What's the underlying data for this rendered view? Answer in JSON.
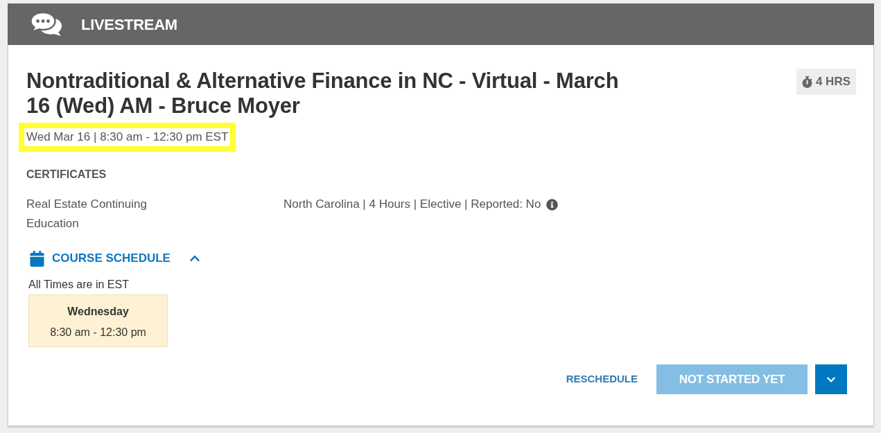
{
  "header": {
    "title": "LIVESTREAM"
  },
  "course": {
    "title": "Nontraditional & Alternative Finance in NC - Virtual - March 16 (Wed) AM - Bruce Moyer",
    "duration": "4 HRS",
    "date": {
      "text": "Wed Mar 16 | 8:30 am - 12:30 pm EST",
      "highlighted": true
    }
  },
  "certificates": {
    "heading": "CERTIFICATES",
    "rows": [
      {
        "name": "Real Estate Continuing Education",
        "details": "North Carolina | 4 Hours | Elective | Reported: No"
      }
    ]
  },
  "schedule": {
    "label": "COURSE SCHEDULE",
    "expanded": true,
    "note": "All Times are in EST",
    "sessions": [
      {
        "day": "Wednesday",
        "time": "8:30 am - 12:30 pm"
      }
    ]
  },
  "actions": {
    "reschedule": "RESCHEDULE",
    "status_button": {
      "label": "NOT STARTED YET",
      "disabled": true
    }
  }
}
